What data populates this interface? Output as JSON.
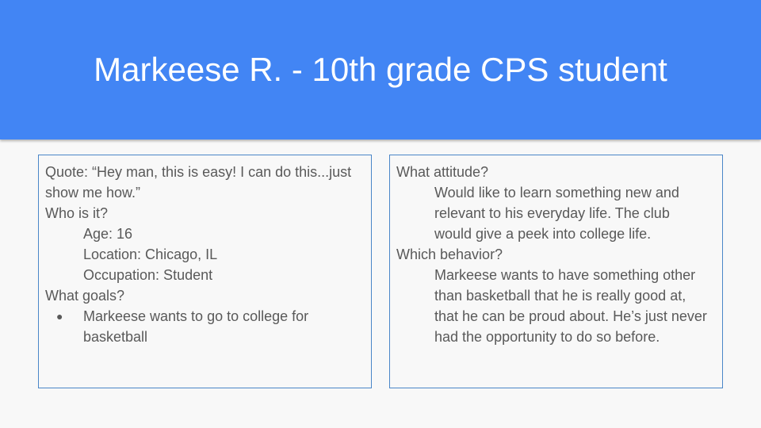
{
  "title": "Markeese R. - 10th grade CPS student",
  "left_box": {
    "quote_line1": "Quote: “Hey man, this is easy! I can do this...just",
    "quote_line2": "show me how.”",
    "who_heading": "Who is it?",
    "age": "Age: 16",
    "location": "Location: Chicago, IL",
    "occupation": "Occupation: Student",
    "goals_heading": "What goals?",
    "goal_bullet": "●",
    "goal_line1": "Markeese wants to go to college for",
    "goal_line2": "basketball"
  },
  "right_box": {
    "attitude_heading": "What attitude?",
    "attitude_line1": "Would like to learn something new and",
    "attitude_line2": "relevant to his everyday life. The club",
    "attitude_line3": "would give a peek into college life.",
    "behavior_heading": "Which behavior?",
    "behavior_line1": "Markeese wants to have something other",
    "behavior_line2": "than basketball that he is really good at,",
    "behavior_line3": "that he can be proud about. He’s just never",
    "behavior_line4": "had the opportunity to do so before."
  }
}
